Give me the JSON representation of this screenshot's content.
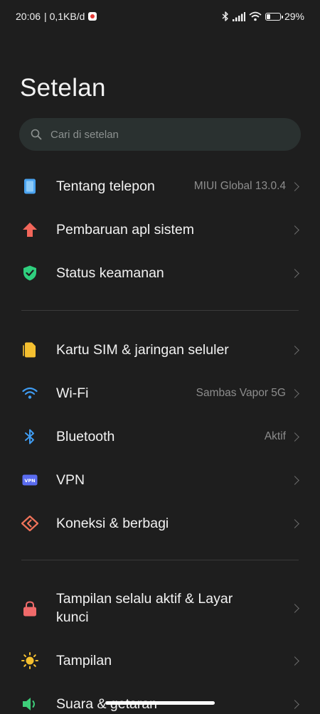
{
  "status_bar": {
    "time": "20:06",
    "speed": "| 0,1KB/d",
    "battery": "29%",
    "battery_level": 0.29,
    "icons": [
      "recording-icon",
      "bluetooth-icon",
      "signal-icon",
      "wifi-icon",
      "battery-icon"
    ]
  },
  "page": {
    "title": "Setelan"
  },
  "search": {
    "placeholder": "Cari di setelan",
    "value": ""
  },
  "groups": [
    {
      "items": [
        {
          "label": "Tentang telepon",
          "value": "MIUI Global 13.0.4",
          "icon": "phone-icon",
          "color": "#4aa3f0"
        },
        {
          "label": "Pembaruan apl sistem",
          "value": "",
          "icon": "arrow-up-icon",
          "color": "#f2665a"
        },
        {
          "label": "Status keamanan",
          "value": "",
          "icon": "shield-icon",
          "color": "#2fcf7e"
        }
      ]
    },
    {
      "items": [
        {
          "label": "Kartu SIM & jaringan seluler",
          "value": "",
          "icon": "sim-icon",
          "color": "#f5c030"
        },
        {
          "label": "Wi-Fi",
          "value": "Sambas Vapor 5G",
          "icon": "wifi-icon",
          "color": "#3f9cf2"
        },
        {
          "label": "Bluetooth",
          "value": "Aktif",
          "icon": "bluetooth-icon",
          "color": "#3f9cf2"
        },
        {
          "label": "VPN",
          "value": "",
          "icon": "vpn-icon",
          "color": "#5a6cf0"
        },
        {
          "label": "Koneksi & berbagi",
          "value": "",
          "icon": "connection-share-icon",
          "color": "#f0735a"
        }
      ]
    },
    {
      "items": [
        {
          "label": "Tampilan selalu aktif & Layar kunci",
          "value": "",
          "icon": "lock-icon",
          "color": "#f06a6a"
        },
        {
          "label": "Tampilan",
          "value": "",
          "icon": "sun-icon",
          "color": "#f5c030"
        },
        {
          "label": "Suara & getaran",
          "value": "",
          "icon": "speaker-icon",
          "color": "#3ecf7a"
        }
      ]
    }
  ]
}
